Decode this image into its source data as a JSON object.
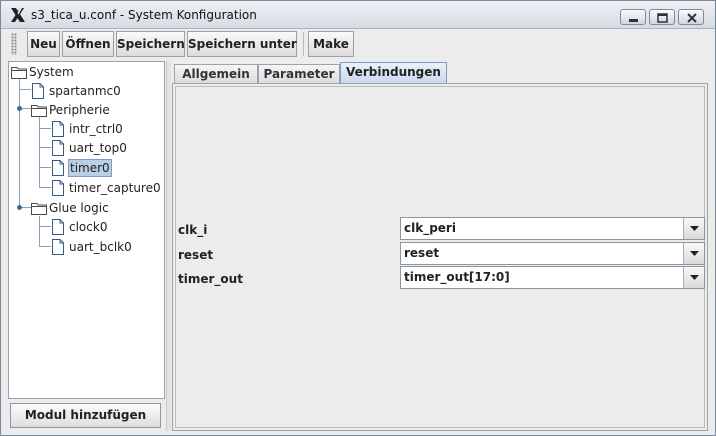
{
  "window": {
    "title": "s3_tica_u.conf - System Konfiguration"
  },
  "toolbar": {
    "new_label": "Neu",
    "open_label": "Öffnen",
    "save_label": "Speichern",
    "save_as_label": "Speichern unter",
    "make_label": "Make"
  },
  "tree": {
    "root": "System",
    "items": [
      {
        "label": "spartanmc0"
      },
      {
        "label": "Peripherie"
      },
      {
        "label": "intr_ctrl0"
      },
      {
        "label": "uart_top0"
      },
      {
        "label": "timer0"
      },
      {
        "label": "timer_capture0"
      },
      {
        "label": "Glue logic"
      },
      {
        "label": "clock0"
      },
      {
        "label": "uart_bclk0"
      }
    ],
    "selected": "timer0"
  },
  "add_module_label": "Modul hinzufügen",
  "tabs": [
    {
      "label": "Allgemein"
    },
    {
      "label": "Parameter"
    },
    {
      "label": "Verbindungen"
    }
  ],
  "active_tab": "Verbindungen",
  "connections": [
    {
      "label": "clk_i",
      "value": "clk_peri"
    },
    {
      "label": "reset",
      "value": "reset"
    },
    {
      "label": "timer_out",
      "value": "timer_out[17:0]"
    }
  ],
  "colors": {
    "selection": "#b8cfe5",
    "active_tab": "#c6d8ec"
  }
}
